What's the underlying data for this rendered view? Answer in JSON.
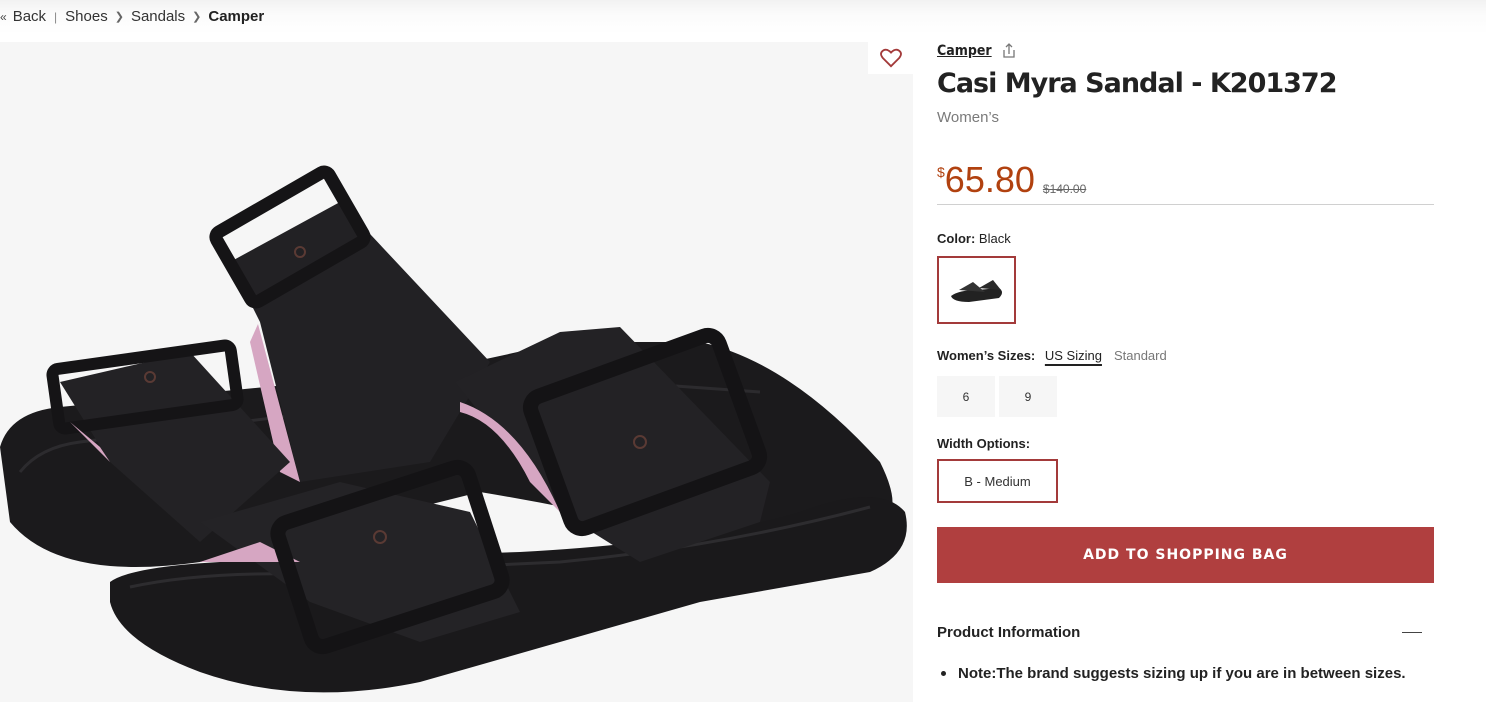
{
  "breadcrumb": {
    "back_label": "Back",
    "items": [
      "Shoes",
      "Sandals"
    ],
    "current": "Camper"
  },
  "product": {
    "brand": "Camper",
    "title": "Casi Myra Sandal - K201372",
    "gender": "Women’s",
    "currency_symbol": "$",
    "price": "65.80",
    "original_price": "$140.00"
  },
  "color": {
    "label": "Color:",
    "value": "Black"
  },
  "sizes": {
    "label": "Women’s Sizes:",
    "tabs": [
      "US Sizing",
      "Standard"
    ],
    "options": [
      "6",
      "9"
    ]
  },
  "width": {
    "label": "Width Options:",
    "selected": "B - Medium"
  },
  "cart": {
    "button_label": "ADD TO SHOPPING BAG"
  },
  "info": {
    "title": "Product Information",
    "note_label": "Note:",
    "note_text": " The brand suggests sizing up if you are in between sizes."
  },
  "icons": [
    "heart-icon",
    "share-icon",
    "collapse-icon",
    "chevron-right-icon",
    "double-chevron-left-icon"
  ],
  "colors": {
    "price": "#b1410f",
    "accent": "#b03f3f"
  }
}
